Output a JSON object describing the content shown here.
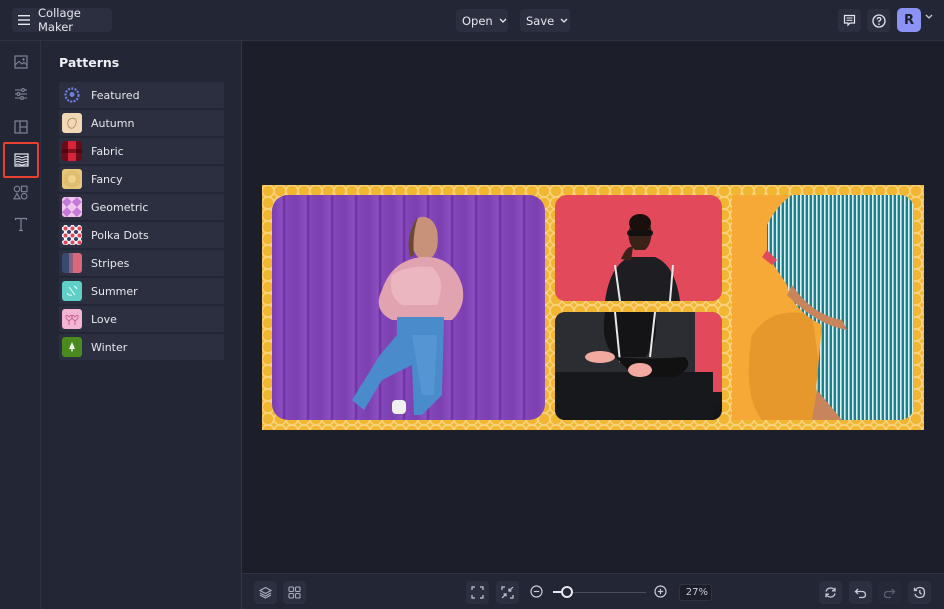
{
  "app": {
    "title": "Collage Maker",
    "menu_icon": "hamburger-icon"
  },
  "header": {
    "open_label": "Open",
    "save_label": "Save",
    "chat_icon": "comment-icon",
    "help_icon": "help-icon",
    "avatar_initial": "R",
    "avatar_color": "#8b94f5"
  },
  "rail": {
    "items": [
      {
        "name": "photos",
        "icon": "image-icon"
      },
      {
        "name": "adjust",
        "icon": "sliders-icon"
      },
      {
        "name": "layouts",
        "icon": "layout-icon"
      },
      {
        "name": "patterns",
        "icon": "pattern-icon",
        "active": true
      },
      {
        "name": "graphics",
        "icon": "shapes-icon"
      },
      {
        "name": "text",
        "icon": "text-icon"
      }
    ],
    "active_highlight_color": "#e8412c"
  },
  "panel": {
    "title": "Patterns",
    "items": [
      {
        "label": "Featured"
      },
      {
        "label": "Autumn"
      },
      {
        "label": "Fabric"
      },
      {
        "label": "Fancy"
      },
      {
        "label": "Geometric"
      },
      {
        "label": "Polka Dots"
      },
      {
        "label": "Stripes"
      },
      {
        "label": "Summer"
      },
      {
        "label": "Love"
      },
      {
        "label": "Winter"
      }
    ]
  },
  "canvas": {
    "background_pattern_color": "#f2b632",
    "cells": [
      {
        "description": "woman in pink jacket against purple wall"
      },
      {
        "description": "woman with sunglasses against red wall (top)"
      },
      {
        "description": "woman sitting on black leather sofa (bottom)"
      },
      {
        "description": "person in teal striped shirt dress against orange wall"
      }
    ]
  },
  "footer": {
    "zoom_percent_label": "27%",
    "zoom_slider_fraction": 0.15
  }
}
